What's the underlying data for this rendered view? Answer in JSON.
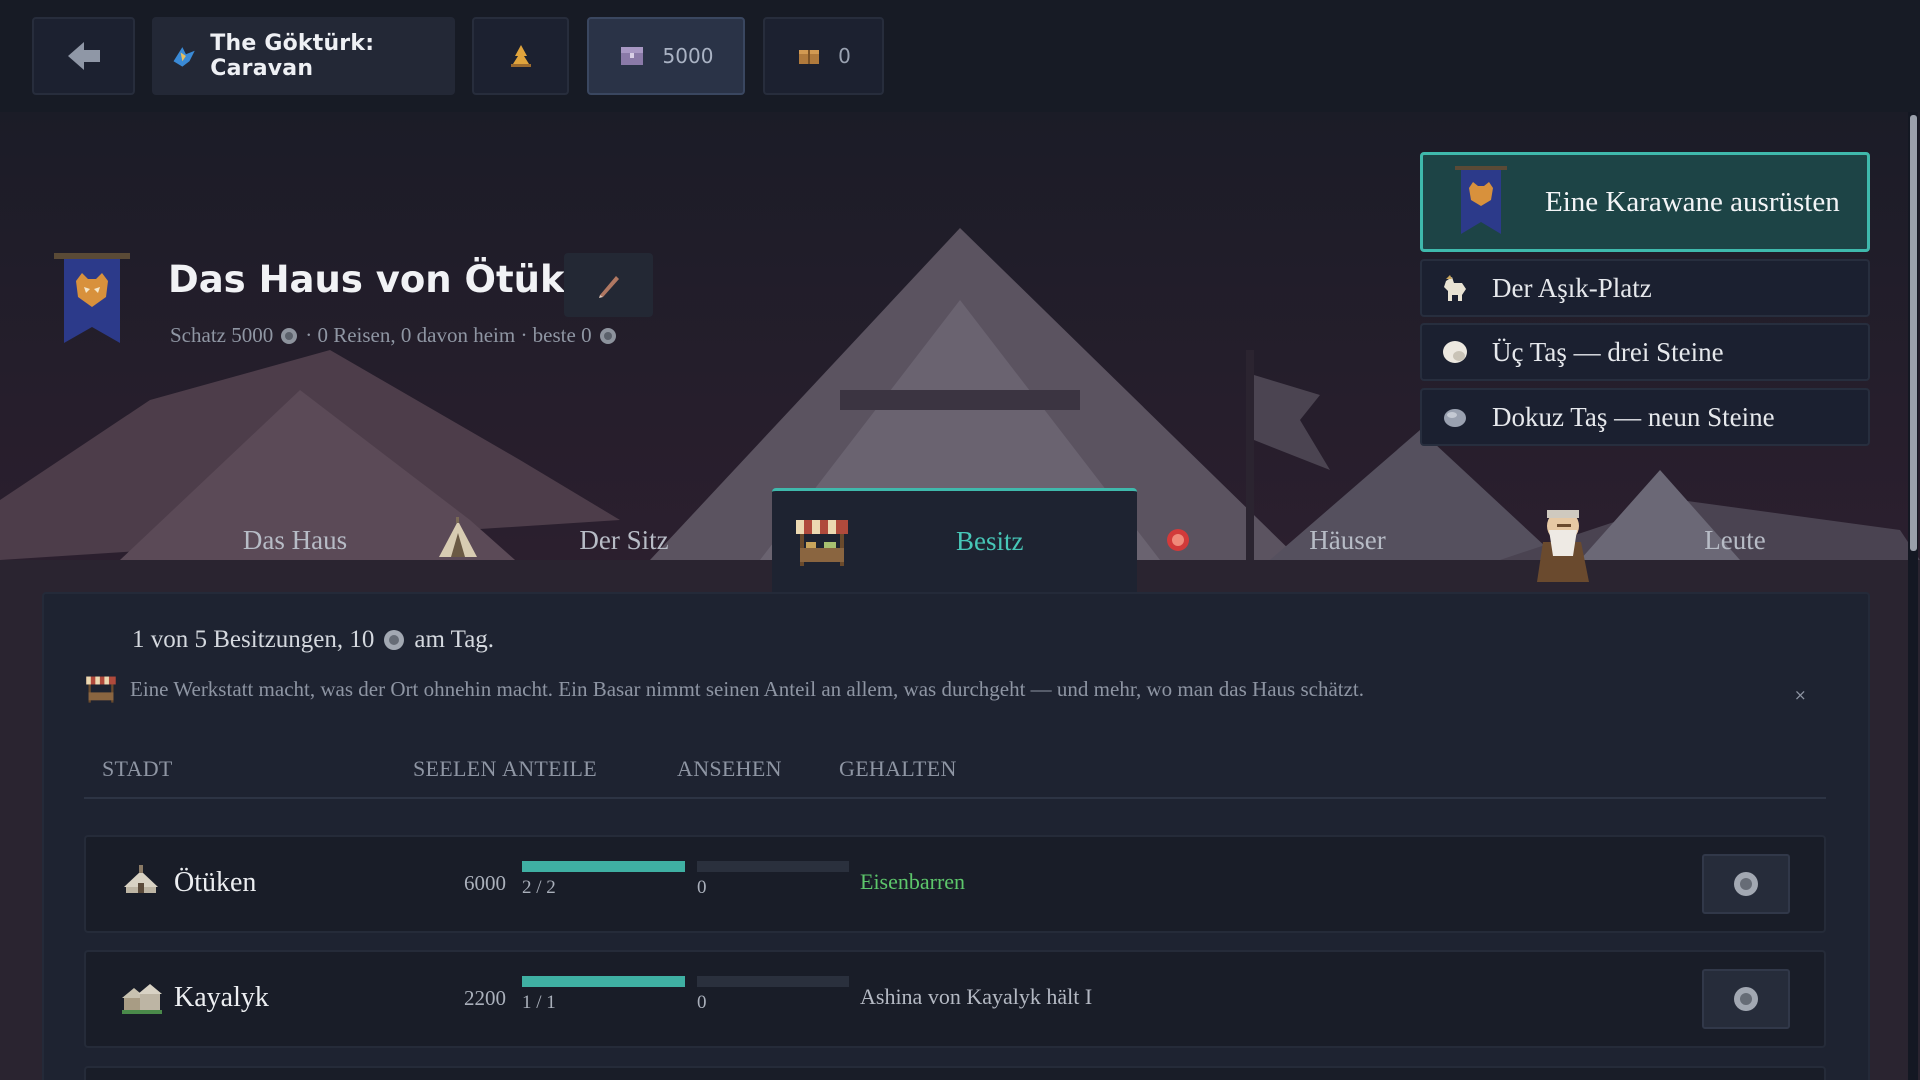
{
  "topbar": {
    "back_icon": "arrow-left-icon",
    "title": "The Göktürk: Caravan",
    "title_icon": "wolf-emblem-icon",
    "camp_icon": "campfire-icon",
    "treasure_icon": "treasure-chest-icon",
    "treasure_value": "5000",
    "goods_icon": "crate-icon",
    "goods_value": "0"
  },
  "house": {
    "title": "Das Haus von Ötüken",
    "banner_icon": "wolf-banner-icon",
    "edit_icon": "pen-icon",
    "subtitle_treasure": "Schatz 5000",
    "subtitle_journeys": "· 0 Reisen, 0 davon heim · beste 0"
  },
  "menu": {
    "primary_label": "Eine Karawane ausrüsten",
    "items": [
      {
        "label": "Der Aşık-Platz",
        "icon": "goat-icon"
      },
      {
        "label": "Üç Taş — drei Steine",
        "icon": "white-stone-icon"
      },
      {
        "label": "Dokuz Taş — neun Steine",
        "icon": "grey-stone-icon"
      }
    ]
  },
  "tabs": [
    {
      "label": "Das Haus",
      "icon": "tent-icon"
    },
    {
      "label": "Der Sitz",
      "icon": "market-stall-icon"
    },
    {
      "label": "Besitz",
      "icon": "red-seal-icon",
      "active": true
    },
    {
      "label": "Häuser",
      "icon": "elder-portrait-icon"
    },
    {
      "label": "Leute"
    }
  ],
  "panel": {
    "summary_text": "1 von 5 Besitzungen, 10",
    "summary_suffix": "am Tag.",
    "hint": "Eine Werkstatt macht, was der Ort ohnehin macht. Ein Basar nimmt seinen Anteil an allem, was durchgeht — und mehr, wo man das Haus schätzt.",
    "hint_close": "×",
    "columns": {
      "city": "STADT",
      "souls": "SEELEN",
      "shares": "ANTEILE",
      "reputation": "ANSEHEN",
      "held": "GEHALTEN"
    }
  },
  "rows": [
    {
      "city": "Ötüken",
      "souls": "6000",
      "shares_text": "2 / 2",
      "shares_fraction": 1.0,
      "reputation": "0",
      "reputation_fraction": 0.0,
      "held": "Eisenbarren",
      "icon": "yurt-city-icon"
    },
    {
      "city": "Kayalyk",
      "souls": "2200",
      "shares_text": "1 / 1",
      "shares_fraction": 1.0,
      "reputation": "0",
      "reputation_fraction": 0.0,
      "held": "Ashina von Kayalyk hält I",
      "icon": "town-city-icon"
    }
  ],
  "colors": {
    "accent": "#3fb9ac",
    "held_good": "#5dc66b",
    "panel": "#1e2331",
    "topbar": "#171b25"
  }
}
